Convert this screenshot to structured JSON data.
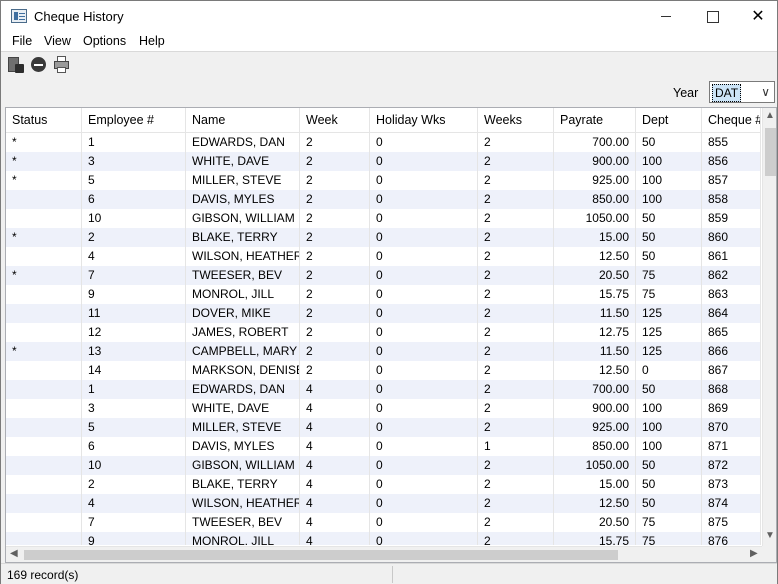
{
  "window": {
    "title": "Cheque History",
    "minimize": "",
    "maximize": "",
    "close": "✕"
  },
  "menu": [
    "File",
    "View",
    "Options",
    "Help"
  ],
  "toolbar": {
    "icons": [
      "save-icon",
      "stop-icon",
      "print-icon"
    ]
  },
  "filter": {
    "year_label": "Year",
    "year_value": "DAT"
  },
  "table": {
    "columns": [
      "Status",
      "Employee #",
      "Name",
      "Week",
      "Holiday Wks",
      "Weeks",
      "Payrate",
      "Dept",
      "Cheque #"
    ],
    "rows": [
      [
        "*",
        "1",
        "EDWARDS, DAN",
        "2",
        "0",
        "2",
        "700.00",
        "50",
        "855"
      ],
      [
        "*",
        "3",
        "WHITE, DAVE",
        "2",
        "0",
        "2",
        "900.00",
        "100",
        "856"
      ],
      [
        "*",
        "5",
        "MILLER, STEVE",
        "2",
        "0",
        "2",
        "925.00",
        "100",
        "857"
      ],
      [
        "",
        "6",
        "DAVIS, MYLES",
        "2",
        "0",
        "2",
        "850.00",
        "100",
        "858"
      ],
      [
        "",
        "10",
        "GIBSON, WILLIAM",
        "2",
        "0",
        "2",
        "1050.00",
        "50",
        "859"
      ],
      [
        "*",
        "2",
        "BLAKE, TERRY",
        "2",
        "0",
        "2",
        "15.00",
        "50",
        "860"
      ],
      [
        "",
        "4",
        "WILSON, HEATHER",
        "2",
        "0",
        "2",
        "12.50",
        "50",
        "861"
      ],
      [
        "*",
        "7",
        "TWEESER, BEV",
        "2",
        "0",
        "2",
        "20.50",
        "75",
        "862"
      ],
      [
        "",
        "9",
        "MONROL, JILL",
        "2",
        "0",
        "2",
        "15.75",
        "75",
        "863"
      ],
      [
        "",
        "11",
        "DOVER, MIKE",
        "2",
        "0",
        "2",
        "11.50",
        "125",
        "864"
      ],
      [
        "",
        "12",
        "JAMES, ROBERT",
        "2",
        "0",
        "2",
        "12.75",
        "125",
        "865"
      ],
      [
        "*",
        "13",
        "CAMPBELL, MARY",
        "2",
        "0",
        "2",
        "11.50",
        "125",
        "866"
      ],
      [
        "",
        "14",
        "MARKSON, DENISE",
        "2",
        "0",
        "2",
        "12.50",
        "0",
        "867"
      ],
      [
        "",
        "1",
        "EDWARDS, DAN",
        "4",
        "0",
        "2",
        "700.00",
        "50",
        "868"
      ],
      [
        "",
        "3",
        "WHITE, DAVE",
        "4",
        "0",
        "2",
        "900.00",
        "100",
        "869"
      ],
      [
        "",
        "5",
        "MILLER, STEVE",
        "4",
        "0",
        "2",
        "925.00",
        "100",
        "870"
      ],
      [
        "",
        "6",
        "DAVIS, MYLES",
        "4",
        "0",
        "1",
        "850.00",
        "100",
        "871"
      ],
      [
        "",
        "10",
        "GIBSON, WILLIAM",
        "4",
        "0",
        "2",
        "1050.00",
        "50",
        "872"
      ],
      [
        "",
        "2",
        "BLAKE, TERRY",
        "4",
        "0",
        "2",
        "15.00",
        "50",
        "873"
      ],
      [
        "",
        "4",
        "WILSON, HEATHER",
        "4",
        "0",
        "2",
        "12.50",
        "50",
        "874"
      ],
      [
        "",
        "7",
        "TWEESER, BEV",
        "4",
        "0",
        "2",
        "20.50",
        "75",
        "875"
      ],
      [
        "",
        "9",
        "MONROL, JILL",
        "4",
        "0",
        "2",
        "15.75",
        "75",
        "876"
      ]
    ]
  },
  "status": {
    "records": "169 record(s)"
  }
}
